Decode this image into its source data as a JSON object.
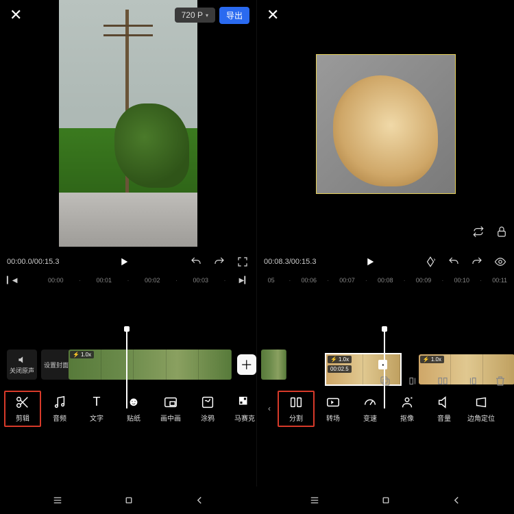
{
  "left": {
    "resolution": "720 P",
    "export": "导出",
    "time": "00:00.0/00:15.3",
    "ruler": [
      "00:00",
      "00:01",
      "00:02",
      "00:03"
    ],
    "audio_off": "关闭原声",
    "cover": "设置封面",
    "speed": "1.0x",
    "tools": {
      "edit": "剪辑",
      "audio": "音频",
      "text": "文字",
      "sticker": "贴纸",
      "pip": "画中画",
      "doodle": "涂鸦",
      "mosaic": "马赛克"
    }
  },
  "right": {
    "time": "00:08.3/00:15.3",
    "ruler": [
      "05",
      "00:06",
      "00:07",
      "00:08",
      "00:09",
      "00:10",
      "00:11"
    ],
    "clip_speed1": "1.0x",
    "clip_dur1": "00:02.5",
    "clip_speed2": "1.0x",
    "tools": {
      "split": "分割",
      "transition": "转场",
      "speed": "变速",
      "cutout": "抠像",
      "volume": "音量",
      "corner": "边角定位"
    }
  }
}
